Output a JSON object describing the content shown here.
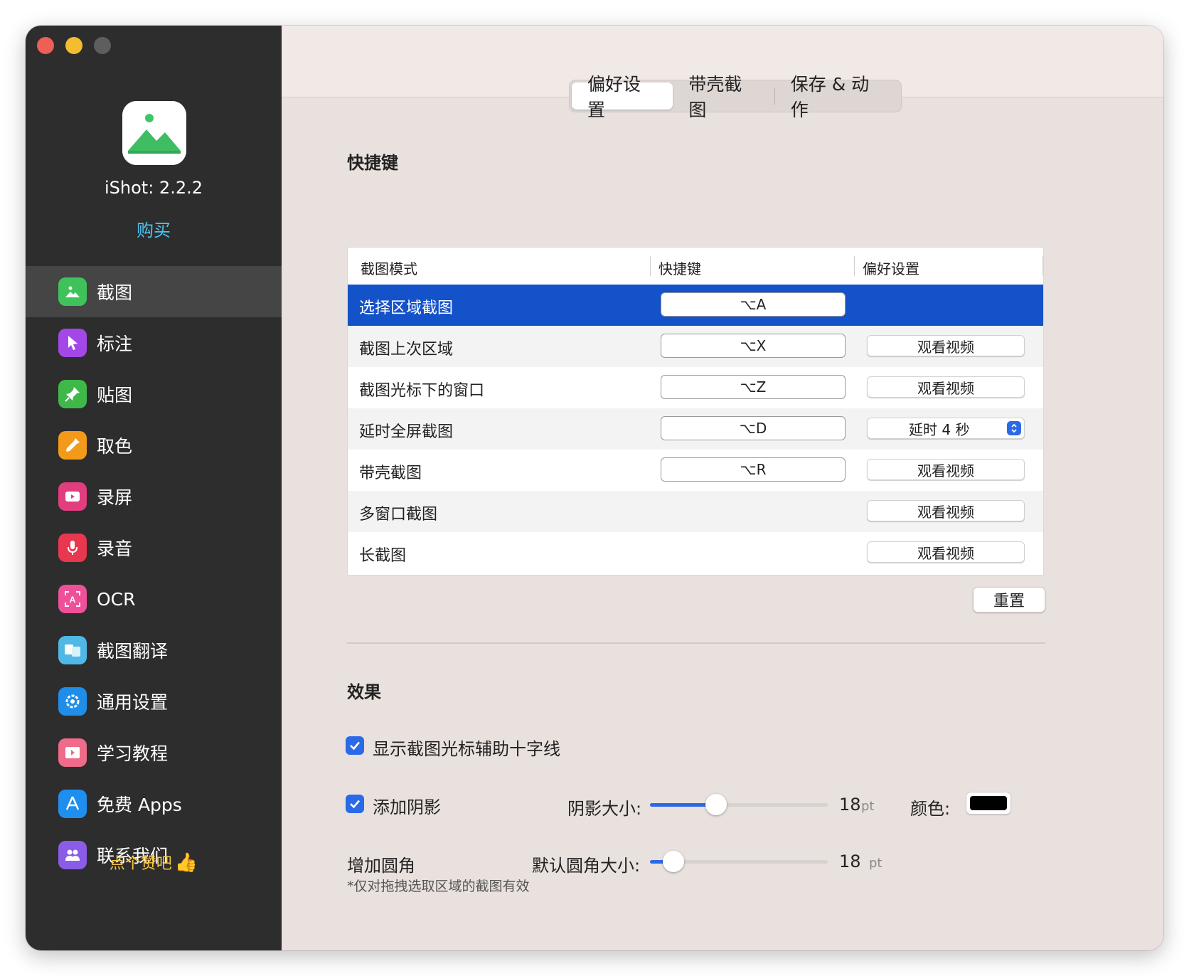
{
  "app": {
    "version_label": "iShot: 2.2.2",
    "buy_label": "购买",
    "like_label": "点个赞吧",
    "like_emoji": "👍"
  },
  "sidebar": {
    "items": [
      {
        "label": "截图",
        "icon": "image-icon",
        "color": "#3fc25a"
      },
      {
        "label": "标注",
        "icon": "pointer-icon",
        "color": "#a347e8"
      },
      {
        "label": "贴图",
        "icon": "pin-icon",
        "color": "#3fb84a"
      },
      {
        "label": "取色",
        "icon": "eyedropper-icon",
        "color": "#f39a1b"
      },
      {
        "label": "录屏",
        "icon": "video-icon",
        "color": "#e23d7e"
      },
      {
        "label": "录音",
        "icon": "microphone-icon",
        "color": "#e8384f"
      },
      {
        "label": "OCR",
        "icon": "ocr-icon",
        "color": "#f0509a"
      },
      {
        "label": "截图翻译",
        "icon": "translate-icon",
        "color": "#4fb8e6"
      },
      {
        "label": "通用设置",
        "icon": "gear-icon",
        "color": "#1e8ee8"
      },
      {
        "label": "学习教程",
        "icon": "film-icon",
        "color": "#f06a8a"
      },
      {
        "label": "免费 Apps",
        "icon": "appstore-icon",
        "color": "#1f8fef"
      },
      {
        "label": "联系我们",
        "icon": "people-icon",
        "color": "#8a5ce8"
      }
    ]
  },
  "tabs": [
    "偏好设置",
    "带壳截图",
    "保存 & 动作"
  ],
  "shortcuts": {
    "title": "快捷键",
    "columns": [
      "截图模式",
      "快捷键",
      "偏好设置"
    ],
    "rows": [
      {
        "mode": "选择区域截图",
        "shortcut": "⌥A",
        "pref": ""
      },
      {
        "mode": "截图上次区域",
        "shortcut": "⌥X",
        "pref": "观看视频"
      },
      {
        "mode": "截图光标下的窗口",
        "shortcut": "⌥Z",
        "pref": "观看视频"
      },
      {
        "mode": "延时全屏截图",
        "shortcut": "⌥D",
        "pref": "延时 4 秒"
      },
      {
        "mode": "带壳截图",
        "shortcut": "⌥R",
        "pref": "观看视频"
      },
      {
        "mode": "多窗口截图",
        "shortcut": "",
        "pref": "观看视频"
      },
      {
        "mode": "长截图",
        "shortcut": "",
        "pref": "观看视频"
      }
    ],
    "reset_label": "重置"
  },
  "effects": {
    "title": "效果",
    "crosshair_label": "显示截图光标辅助十字线",
    "crosshair_checked": true,
    "shadow_label": "添加阴影",
    "shadow_checked": true,
    "shadow_size_label": "阴影大小:",
    "shadow_size_value": "18",
    "shadow_size_fraction": 0.37,
    "unit": "pt",
    "color_label": "颜色:",
    "shadow_color": "#000000",
    "corner_label": "增加圆角",
    "corner_size_label": "默认圆角大小:",
    "corner_size_value": "18",
    "corner_size_fraction": 0.13,
    "corner_note": "*仅对拖拽选取区域的截图有效"
  },
  "accent_color": "#1452c9"
}
